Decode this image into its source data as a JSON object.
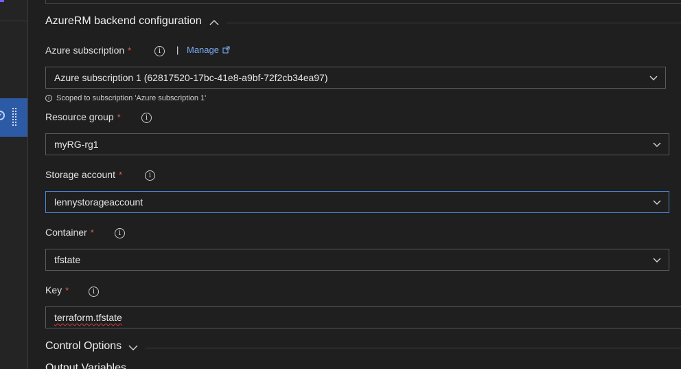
{
  "section": {
    "title": "AzureRM backend configuration",
    "control_options": "Control Options",
    "output_variables": "Output Variables"
  },
  "subscription": {
    "label": "Azure subscription",
    "required": "*",
    "manage": "Manage",
    "separator": "|",
    "value": "Azure subscription 1 (62817520-17bc-41e8-a9bf-72f2cb34ea97)",
    "hint": "Scoped to subscription 'Azure subscription 1'"
  },
  "resource_group": {
    "label": "Resource group",
    "required": "*",
    "value": "myRG-rg1"
  },
  "storage_account": {
    "label": "Storage account",
    "required": "*",
    "value": "lennystorageaccount"
  },
  "container": {
    "label": "Container",
    "required": "*",
    "value": "tfstate"
  },
  "key": {
    "label": "Key",
    "required": "*",
    "value": "terraform.tfstate"
  },
  "icons": {
    "info": "info-icon",
    "chevron": "chevron-down-icon",
    "external": "external-link-icon"
  },
  "colors": {
    "accent": "#4d86d8",
    "link": "#7aa9ee",
    "required": "#e05a5a",
    "selected_rail": "#2d5aa5"
  }
}
